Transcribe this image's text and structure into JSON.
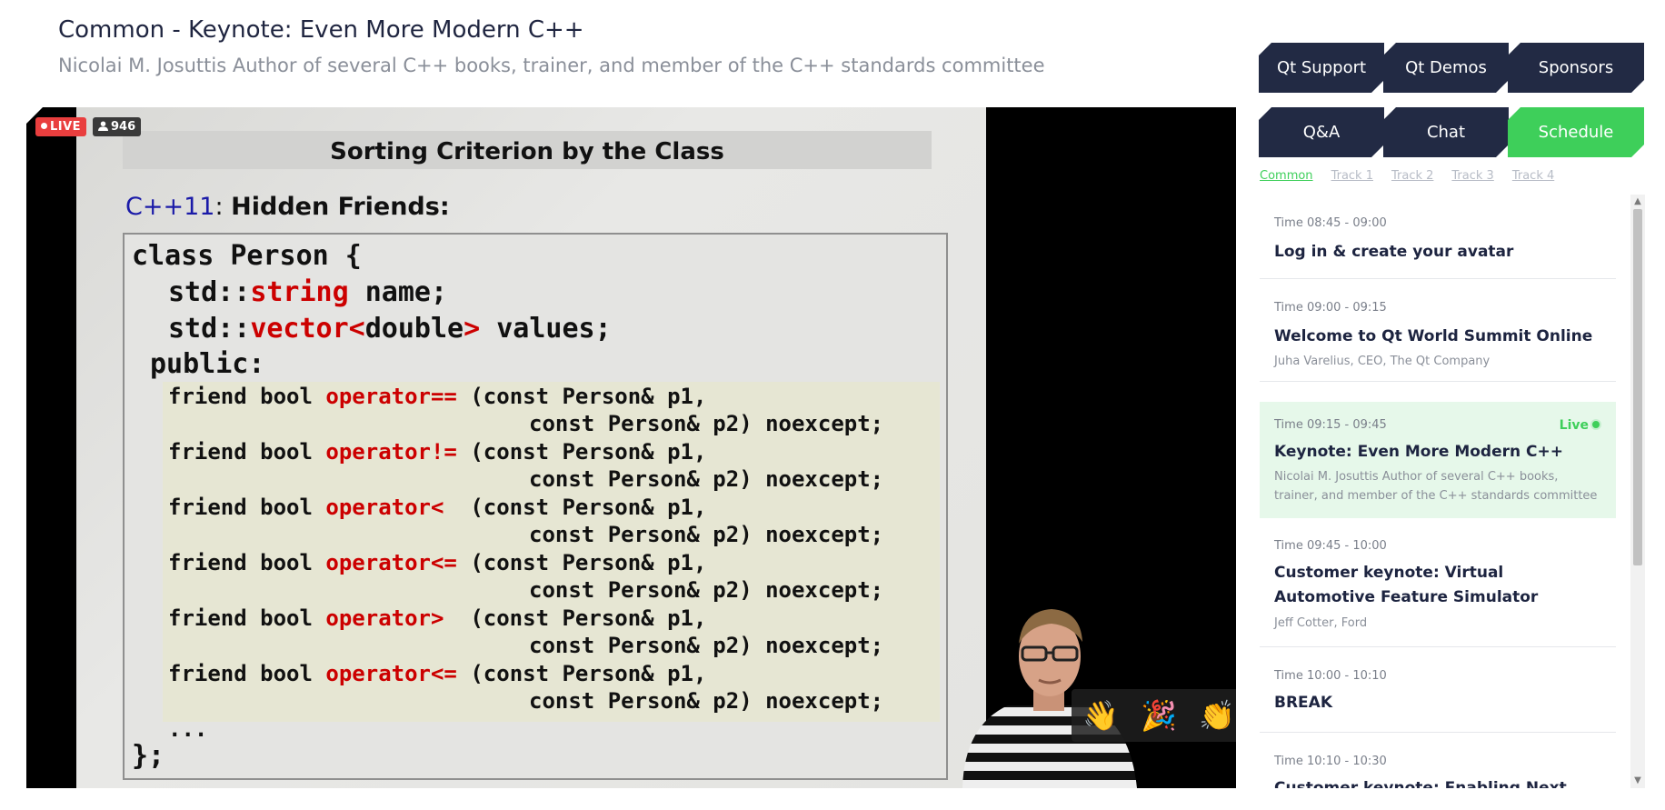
{
  "header": {
    "title": "Common - Keynote: Even More Modern C++",
    "subtitle": "Nicolai M. Josuttis Author of several C++ books, trainer, and member of the C++ standards committee"
  },
  "video": {
    "live_label": "LIVE",
    "viewer_count": "946",
    "slide": {
      "title": "Sorting Criterion by the Class",
      "subtitle_prefix": "C++11",
      "subtitle_sep": ": ",
      "subtitle_main": "Hidden Friends:",
      "watermark": "@"
    },
    "reactions": [
      "👋",
      "🎉",
      "👏"
    ]
  },
  "tabs": {
    "row1": [
      "Qt Support",
      "Qt Demos",
      "Sponsors"
    ],
    "row2": [
      "Q&A",
      "Chat",
      "Schedule"
    ]
  },
  "subtabs": [
    "Common",
    "Track 1",
    "Track 2",
    "Track 3",
    "Track 4"
  ],
  "schedule": [
    {
      "time": "Time 08:45 - 09:00",
      "title": "Log in & create your avatar",
      "speaker": ""
    },
    {
      "time": "Time 09:00 - 09:15",
      "title": "Welcome to Qt World Summit Online",
      "speaker": "Juha Varelius, CEO, The Qt Company"
    },
    {
      "time": "Time 09:15 - 09:45",
      "title": "Keynote: Even More Modern C++",
      "speaker": "Nicolai M. Josuttis Author of several C++ books, trainer, and member of the C++ standards committee",
      "live": "Live"
    },
    {
      "time": "Time 09:45 - 10:00",
      "title": "Customer keynote: Virtual Automotive Feature Simulator",
      "speaker": "Jeff Cotter, Ford"
    },
    {
      "time": "Time 10:00 - 10:10",
      "title": "BREAK",
      "speaker": ""
    },
    {
      "time": "Time 10:10 - 10:30",
      "title": "Customer keynote: Enabling Next Generation",
      "speaker": ""
    }
  ],
  "colors": {
    "accent": "#3ecf5a",
    "tab_bg": "#222a44",
    "live_red": "#e93e3e"
  }
}
